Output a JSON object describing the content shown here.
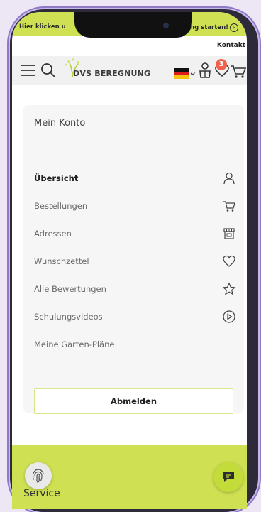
{
  "promo": {
    "left_text": "Hier klicken u",
    "right_text": "ung starten!"
  },
  "header": {
    "kontakt": "Kontakt",
    "logo": "DVS BEREGNUNG",
    "wishlist_count": "3"
  },
  "account": {
    "title": "Mein Konto",
    "items": [
      {
        "label": "Übersicht",
        "icon": "user-icon",
        "active": true
      },
      {
        "label": "Bestellungen",
        "icon": "cart-icon"
      },
      {
        "label": "Adressen",
        "icon": "shop-icon"
      },
      {
        "label": "Wunschzettel",
        "icon": "heart-icon"
      },
      {
        "label": "Alle Bewertungen",
        "icon": "star-icon"
      },
      {
        "label": "Schulungsvideos",
        "icon": "play-icon"
      },
      {
        "label": "Meine Garten-Pläne",
        "icon": ""
      }
    ],
    "logout": "Abmelden"
  },
  "footer": {
    "service": "Service"
  },
  "colors": {
    "accent": "#cfe053",
    "badge": "#f0604b"
  }
}
